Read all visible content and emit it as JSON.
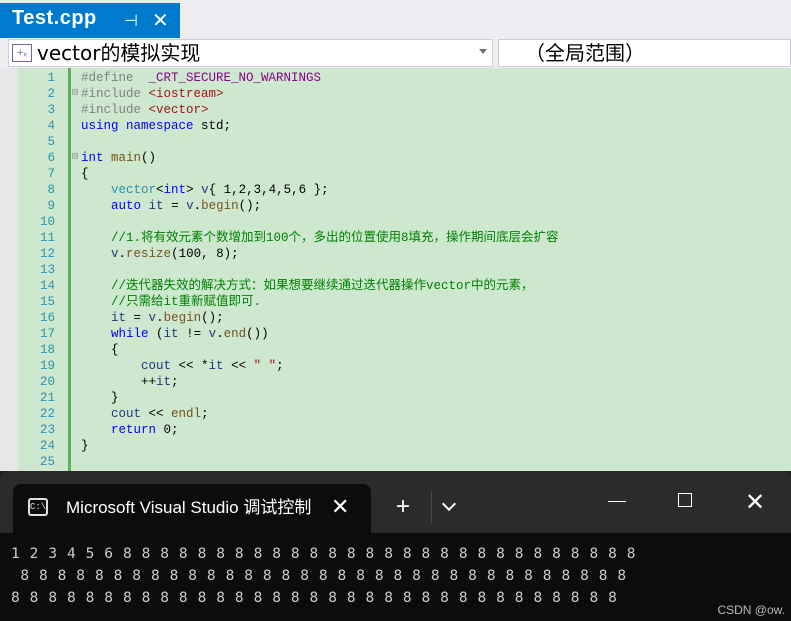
{
  "tab": {
    "title": "Test.cpp",
    "pin": "⊣",
    "close": "✕"
  },
  "nav": {
    "scope_left": "vector的模拟实现",
    "scope_right": "（全局范围）",
    "icon": "+ₓ"
  },
  "editor": {
    "line_numbers": [
      "1",
      "2",
      "3",
      "4",
      "5",
      "6",
      "7",
      "8",
      "9",
      "10",
      "11",
      "12",
      "13",
      "14",
      "15",
      "16",
      "17",
      "18",
      "19",
      "20",
      "21",
      "22",
      "23",
      "24",
      "25"
    ],
    "comment_line11": "//1.将有效元素个数增加到100个，多出的位置使用8填充，操作期间底层会扩容",
    "comment_line14": "//迭代器失效的解决方式：如果想要继续通过迭代器操作vector中的元素，",
    "comment_line15": "//只需给it重新赋值即可."
  },
  "terminal": {
    "tab_title": "Microsoft Visual Studio 调试控制台",
    "icon": "C:\\",
    "add": "+",
    "output_line1": "1 2 3 4 5 6 8 8 8 8 8 8 8 8 8 8 8 8 8 8 8 8 8 8 8 8 8 8 8 8 8 8 8 8",
    "output_line2": " 8 8 8 8 8 8 8 8 8 8 8 8 8 8 8 8 8 8 8 8 8 8 8 8 8 8 8 8 8 8 8 8 8",
    "output_line3": "8 8 8 8 8 8 8 8 8 8 8 8 8 8 8 8 8 8 8 8 8 8 8 8 8 8 8 8 8 8 8 8 8"
  },
  "watermark": "CSDN @ow."
}
